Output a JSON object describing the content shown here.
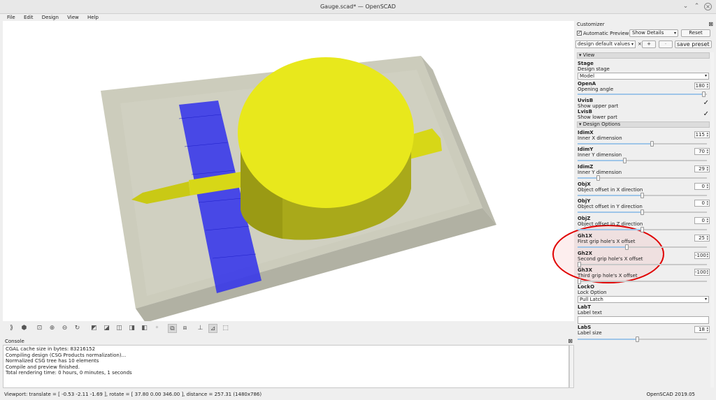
{
  "window": {
    "title": "Gauge.scad* — OpenSCAD",
    "menus": [
      "File",
      "Edit",
      "Design",
      "View",
      "Help"
    ]
  },
  "console": {
    "title": "Console",
    "lines": [
      "CGAL cache size in bytes: 83216152",
      "Compiling design (CSG Products normalization)...",
      "Normalized CSG tree has 10 elements",
      "Compile and preview finished.",
      "Total rendering time: 0 hours, 0 minutes, 1 seconds"
    ]
  },
  "status": {
    "viewport": "Viewport: translate = [ -0.53 -2.11 -1.69 ], rotate = [ 37.80 0.00 346.00 ], distance = 257.31 (1480x786)",
    "version": "OpenSCAD 2019.05"
  },
  "customizer": {
    "title": "Customizer",
    "auto_preview": "Automatic Preview",
    "show_details": "Show Details",
    "reset": "Reset",
    "preset": "design default values",
    "add": "+",
    "remove": "-",
    "save_preset": "save preset",
    "sections": {
      "view": "View",
      "design": "Design Options"
    },
    "params": {
      "stage": {
        "name": "Stage",
        "desc": "Design stage",
        "value": "Model"
      },
      "openA": {
        "name": "OpenA",
        "desc": "Opening angle",
        "value": "180",
        "fraction": 0.99
      },
      "uvisB": {
        "name": "UvisB",
        "desc": "Show upper part",
        "checked": "✓"
      },
      "lvisB": {
        "name": "LvisB",
        "desc": "Show lower part",
        "checked": "✓"
      },
      "idimX": {
        "name": "IdimX",
        "desc": "Inner X dimension",
        "value": "115",
        "fraction": 0.58
      },
      "idimY": {
        "name": "IdimY",
        "desc": "Inner Y dimension",
        "value": "70",
        "fraction": 0.36
      },
      "idimZ": {
        "name": "IdimZ",
        "desc": "Inner Y dimension",
        "value": "29",
        "fraction": 0.15
      },
      "objX": {
        "name": "ObjX",
        "desc": "Object offset in X direction",
        "value": "0",
        "fraction": 0.5
      },
      "objY": {
        "name": "ObjY",
        "desc": "Object offset in Y direction",
        "value": "0",
        "fraction": 0.5
      },
      "objZ": {
        "name": "ObjZ",
        "desc": "Object offset in Z direction",
        "value": "0",
        "fraction": 0.5
      },
      "gh1X": {
        "name": "Gh1X",
        "desc": "First grip hole's X offset",
        "value": "25",
        "fraction": 0.38
      },
      "gh2X": {
        "name": "Gh2X",
        "desc": "Second grip hole's X offset",
        "value": "-100",
        "fraction": 0.0
      },
      "gh3X": {
        "name": "Gh3X",
        "desc": "Third grip hole's X offset",
        "value": "-100",
        "fraction": 0.0
      },
      "lockO": {
        "name": "LockO",
        "desc": "Lock Option",
        "value": "Pull Latch"
      },
      "labT": {
        "name": "LabT",
        "desc": "Label text",
        "value": ""
      },
      "labS": {
        "name": "LabS",
        "desc": "Label size",
        "value": "18",
        "fraction": 0.46
      }
    }
  },
  "colors": {
    "model": "#e8e81c",
    "blue": "#3333ee",
    "annotation": "#e00000"
  }
}
